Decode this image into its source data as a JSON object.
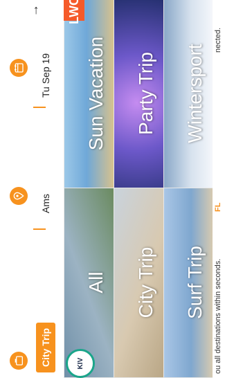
{
  "search": {
    "trip_type": "City Trip",
    "origin": "Ams",
    "date": "Tu Sep 19",
    "next_arrow": "→"
  },
  "categories": [
    {
      "key": "all",
      "label": "All"
    },
    {
      "key": "city",
      "label": "City Trip"
    },
    {
      "key": "surf",
      "label": "Surf Trip"
    },
    {
      "key": "sun",
      "label": "Sun Vacation"
    },
    {
      "key": "party",
      "label": "Party Trip"
    },
    {
      "key": "winter",
      "label": "Wintersport"
    }
  ],
  "brand": {
    "left_text": "KIV",
    "right_text": "LWC"
  },
  "footer": {
    "left": "ou all destinations within seconds.",
    "right": "nected.",
    "hint": "FL"
  },
  "colors": {
    "accent": "#f7921e"
  }
}
